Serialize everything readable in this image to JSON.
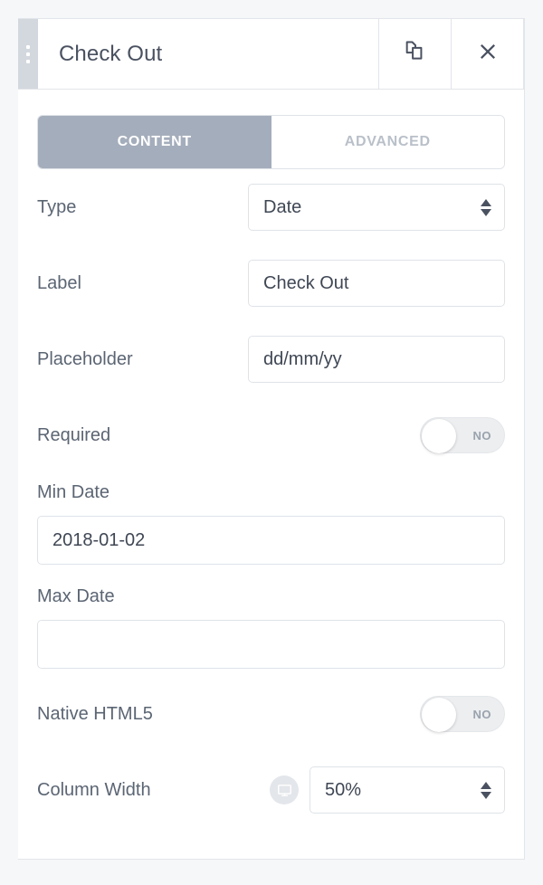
{
  "header": {
    "title": "Check Out",
    "drag_handle_icon": "drag-dots-icon",
    "duplicate_icon": "duplicate-icon",
    "close_icon": "close-icon"
  },
  "tabs": [
    {
      "label": "CONTENT",
      "active": true
    },
    {
      "label": "ADVANCED",
      "active": false
    }
  ],
  "fields": {
    "type": {
      "label": "Type",
      "value": "Date",
      "control": "select",
      "stepper_icon": "stepper-arrows-icon"
    },
    "label": {
      "label": "Label",
      "value": "Check Out",
      "control": "text"
    },
    "placeholder": {
      "label": "Placeholder",
      "value": "dd/mm/yy",
      "control": "text"
    },
    "required": {
      "label": "Required",
      "value": "NO",
      "control": "toggle",
      "on": false
    },
    "min_date": {
      "label": "Min Date",
      "value": "2018-01-02",
      "control": "text"
    },
    "max_date": {
      "label": "Max Date",
      "value": "",
      "control": "text"
    },
    "native_html5": {
      "label": "Native HTML5",
      "value": "NO",
      "control": "toggle",
      "on": false
    },
    "column_width": {
      "label": "Column Width",
      "value": "50%",
      "control": "select",
      "device_icon": "desktop-monitor-icon",
      "stepper_icon": "stepper-arrows-icon"
    }
  },
  "colors": {
    "tab_active_bg": "#a4adbb",
    "label_text": "#5b6573",
    "value_text": "#3f4754",
    "border": "#dfe3e8",
    "toggle_track": "#eceef0",
    "drag_handle": "#d3d8de"
  }
}
